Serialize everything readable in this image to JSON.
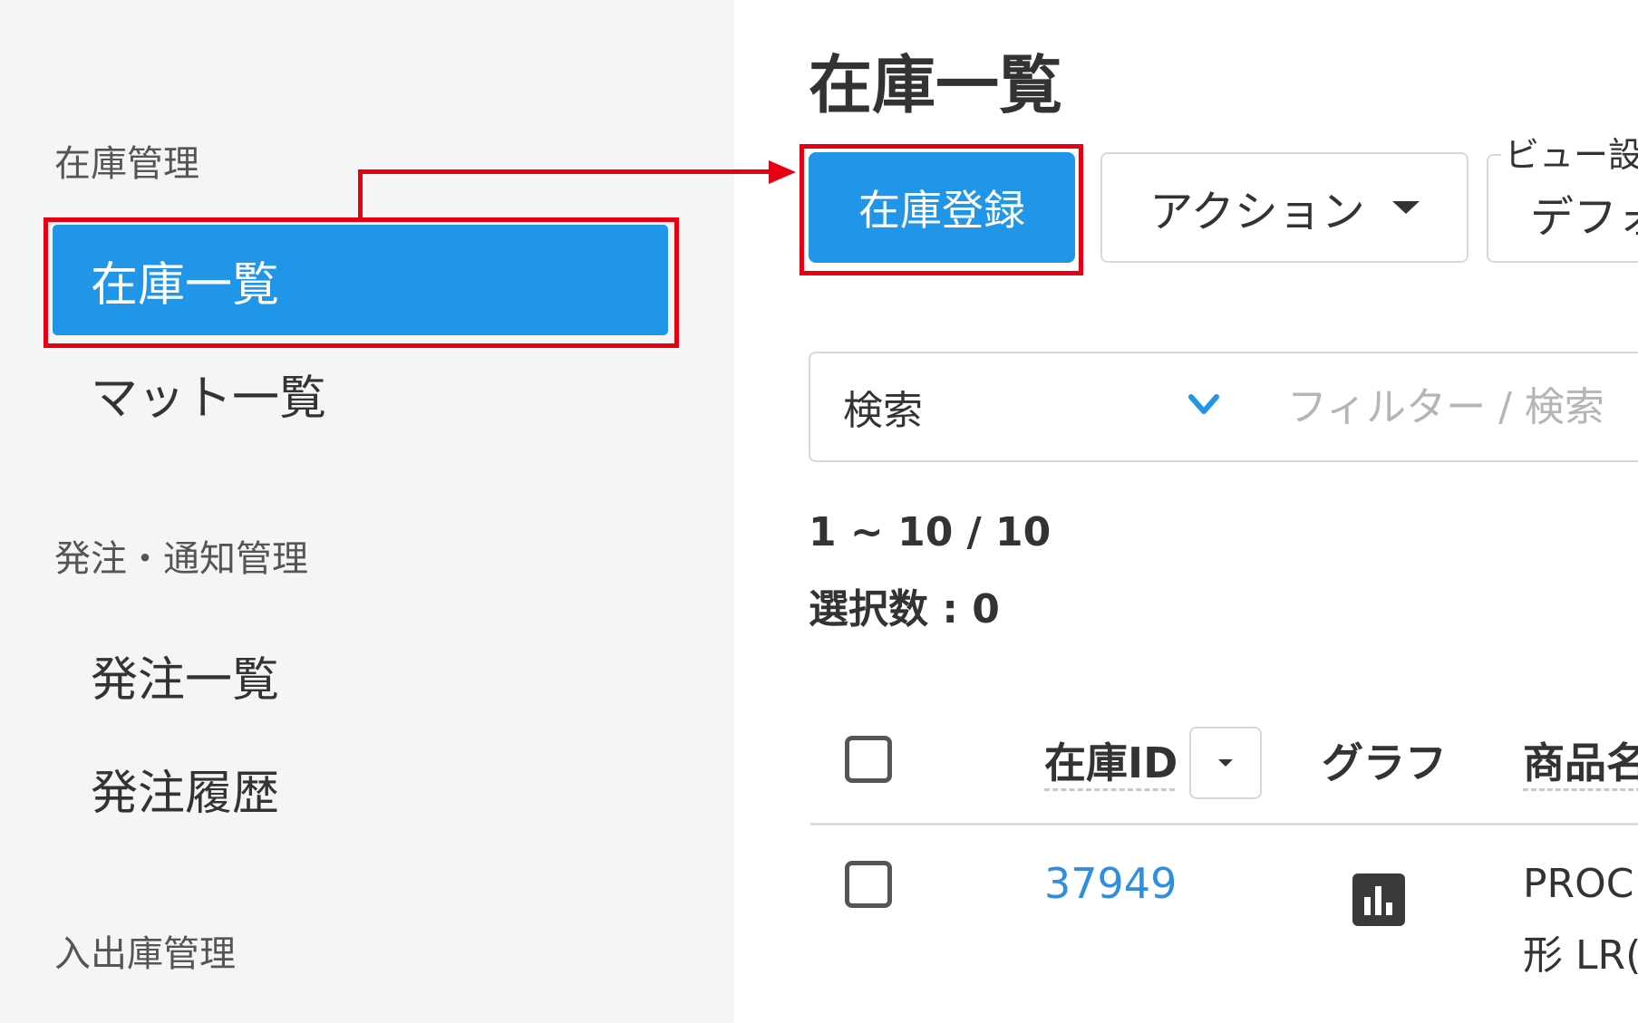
{
  "sidebar": {
    "sections": [
      {
        "label": "在庫管理"
      },
      {
        "label": "発注・通知管理"
      },
      {
        "label": "入出庫管理"
      }
    ],
    "items": [
      {
        "label": "在庫一覧",
        "active": true
      },
      {
        "label": "マット一覧"
      },
      {
        "label": "発注一覧"
      },
      {
        "label": "発注履歴"
      }
    ]
  },
  "main": {
    "title": "在庫一覧",
    "toolbar": {
      "register_label": "在庫登録",
      "action_label": "アクション",
      "view_label": "ビュー設",
      "view_value": "デフォ"
    },
    "search": {
      "field_label": "検索",
      "placeholder": "フィルター / 検索"
    },
    "count": {
      "range": "1 ~ 10 / 10",
      "selected": "選択数 : 0"
    },
    "table": {
      "columns": [
        "在庫ID",
        "グラフ",
        "商品名"
      ],
      "rows": [
        {
          "id": "37949",
          "name_line1": "PROC",
          "name_line2": "形 LR("
        }
      ]
    }
  },
  "colors": {
    "primary": "#2196e8",
    "link": "#2e8fe0",
    "annotation": "#e60012",
    "sidebar_bg": "#f5f5f5"
  },
  "icons": {
    "dropdown_chevron": "chevron-down-icon",
    "sort_caret": "caret-down-icon",
    "graph": "bar-chart-icon"
  }
}
